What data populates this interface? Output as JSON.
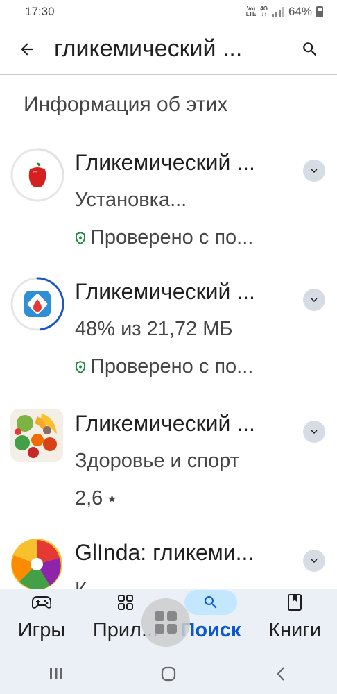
{
  "status_bar": {
    "time": "17:30",
    "volte_top": "Vo)",
    "volte_bottom": "LTE",
    "net_top": "4G",
    "net_bottom": "↓↑",
    "battery": "64%"
  },
  "app_bar": {
    "query": "гликемический ..."
  },
  "section": {
    "title": "Информация об этих"
  },
  "apps": [
    {
      "name": "Гликемический ...",
      "line2": "Установка...",
      "line3": "Проверено с по..."
    },
    {
      "name": "Гликемический ...",
      "line2": "48% из 21,72 МБ",
      "line3": "Проверено с по...",
      "progress_fraction": 0.48
    },
    {
      "name": "Гликемический ...",
      "line2": "Здоровье и спорт",
      "rating": "2,6",
      "star": "★"
    },
    {
      "name": "GlInda: гликеми...",
      "line2": "К"
    }
  ],
  "bottom_nav": {
    "items": [
      {
        "label": "Игры",
        "icon": "gamepad-icon"
      },
      {
        "label": "Прил...",
        "icon": "apps-grid-icon"
      },
      {
        "label": "Поиск",
        "icon": "search-icon",
        "active": true
      },
      {
        "label": "Книги",
        "icon": "book-icon"
      }
    ]
  },
  "colors": {
    "accent": "#0b57d0",
    "active_pill": "#c2e7ff",
    "nav_bg": "#eaf0f5",
    "verified": "#1e8e3e",
    "progress": "#1a56c4"
  }
}
